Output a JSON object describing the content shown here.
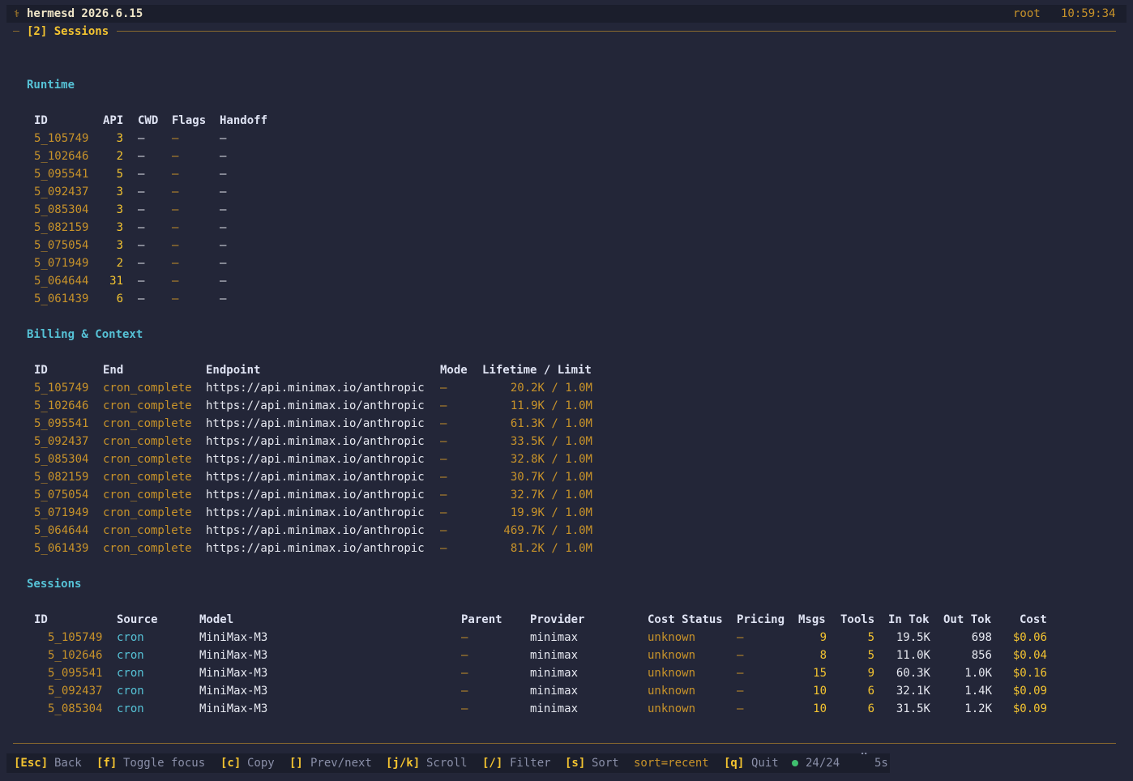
{
  "app": {
    "icon": "caduceus-icon",
    "title": "hermesd 2026.6.15",
    "user": "root",
    "time": "10:59:34",
    "tab": "[2] Sessions"
  },
  "runtime": {
    "heading": "Runtime",
    "columns": [
      "ID",
      "API",
      "CWD",
      "Flags",
      "Handoff"
    ],
    "rows": [
      {
        "id": "5_105749",
        "api": "3",
        "cwd": "—",
        "flags": "—",
        "handoff": "—"
      },
      {
        "id": "5_102646",
        "api": "2",
        "cwd": "—",
        "flags": "—",
        "handoff": "—"
      },
      {
        "id": "5_095541",
        "api": "5",
        "cwd": "—",
        "flags": "—",
        "handoff": "—"
      },
      {
        "id": "5_092437",
        "api": "3",
        "cwd": "—",
        "flags": "—",
        "handoff": "—"
      },
      {
        "id": "5_085304",
        "api": "3",
        "cwd": "—",
        "flags": "—",
        "handoff": "—"
      },
      {
        "id": "5_082159",
        "api": "3",
        "cwd": "—",
        "flags": "—",
        "handoff": "—"
      },
      {
        "id": "5_075054",
        "api": "3",
        "cwd": "—",
        "flags": "—",
        "handoff": "—"
      },
      {
        "id": "5_071949",
        "api": "2",
        "cwd": "—",
        "flags": "—",
        "handoff": "—"
      },
      {
        "id": "5_064644",
        "api": "31",
        "cwd": "—",
        "flags": "—",
        "handoff": "—"
      },
      {
        "id": "5_061439",
        "api": "6",
        "cwd": "—",
        "flags": "—",
        "handoff": "—"
      }
    ]
  },
  "billing": {
    "heading": "Billing & Context",
    "columns": [
      "ID",
      "End",
      "Endpoint",
      "Mode",
      "Lifetime / Limit"
    ],
    "rows": [
      {
        "id": "5_105749",
        "end": "cron_complete",
        "endpoint": "https://api.minimax.io/anthropic",
        "mode": "—",
        "lifetime": "20.2K / 1.0M"
      },
      {
        "id": "5_102646",
        "end": "cron_complete",
        "endpoint": "https://api.minimax.io/anthropic",
        "mode": "—",
        "lifetime": "11.9K / 1.0M"
      },
      {
        "id": "5_095541",
        "end": "cron_complete",
        "endpoint": "https://api.minimax.io/anthropic",
        "mode": "—",
        "lifetime": "61.3K / 1.0M"
      },
      {
        "id": "5_092437",
        "end": "cron_complete",
        "endpoint": "https://api.minimax.io/anthropic",
        "mode": "—",
        "lifetime": "33.5K / 1.0M"
      },
      {
        "id": "5_085304",
        "end": "cron_complete",
        "endpoint": "https://api.minimax.io/anthropic",
        "mode": "—",
        "lifetime": "32.8K / 1.0M"
      },
      {
        "id": "5_082159",
        "end": "cron_complete",
        "endpoint": "https://api.minimax.io/anthropic",
        "mode": "—",
        "lifetime": "30.7K / 1.0M"
      },
      {
        "id": "5_075054",
        "end": "cron_complete",
        "endpoint": "https://api.minimax.io/anthropic",
        "mode": "—",
        "lifetime": "32.7K / 1.0M"
      },
      {
        "id": "5_071949",
        "end": "cron_complete",
        "endpoint": "https://api.minimax.io/anthropic",
        "mode": "—",
        "lifetime": "19.9K / 1.0M"
      },
      {
        "id": "5_064644",
        "end": "cron_complete",
        "endpoint": "https://api.minimax.io/anthropic",
        "mode": "—",
        "lifetime": "469.7K / 1.0M"
      },
      {
        "id": "5_061439",
        "end": "cron_complete",
        "endpoint": "https://api.minimax.io/anthropic",
        "mode": "—",
        "lifetime": "81.2K / 1.0M"
      }
    ]
  },
  "sessions": {
    "heading": "Sessions",
    "columns": [
      "ID",
      "Source",
      "Model",
      "Parent",
      "Provider",
      "Cost Status",
      "Pricing",
      "Msgs",
      "Tools",
      "In Tok",
      "Out Tok",
      "Cost"
    ],
    "rows": [
      {
        "id": "5_105749",
        "source": "cron",
        "model": "MiniMax-M3",
        "parent": "—",
        "provider": "minimax",
        "cost_status": "unknown",
        "pricing": "—",
        "msgs": "9",
        "tools": "5",
        "in_tok": "19.5K",
        "out_tok": "698",
        "cost": "$0.06"
      },
      {
        "id": "5_102646",
        "source": "cron",
        "model": "MiniMax-M3",
        "parent": "—",
        "provider": "minimax",
        "cost_status": "unknown",
        "pricing": "—",
        "msgs": "8",
        "tools": "5",
        "in_tok": "11.0K",
        "out_tok": "856",
        "cost": "$0.04"
      },
      {
        "id": "5_095541",
        "source": "cron",
        "model": "MiniMax-M3",
        "parent": "—",
        "provider": "minimax",
        "cost_status": "unknown",
        "pricing": "—",
        "msgs": "15",
        "tools": "9",
        "in_tok": "60.3K",
        "out_tok": "1.0K",
        "cost": "$0.16"
      },
      {
        "id": "5_092437",
        "source": "cron",
        "model": "MiniMax-M3",
        "parent": "—",
        "provider": "minimax",
        "cost_status": "unknown",
        "pricing": "—",
        "msgs": "10",
        "tools": "6",
        "in_tok": "32.1K",
        "out_tok": "1.4K",
        "cost": "$0.09"
      },
      {
        "id": "5_085304",
        "source": "cron",
        "model": "MiniMax-M3",
        "parent": "—",
        "provider": "minimax",
        "cost_status": "unknown",
        "pricing": "—",
        "msgs": "10",
        "tools": "6",
        "in_tok": "31.5K",
        "out_tok": "1.2K",
        "cost": "$0.09"
      }
    ]
  },
  "footer": {
    "keys": [
      {
        "key": "[Esc]",
        "label": "Back"
      },
      {
        "key": "[f]",
        "label": "Toggle focus"
      },
      {
        "key": "[c]",
        "label": "Copy"
      },
      {
        "key": "[]",
        "label": "Prev/next"
      },
      {
        "key": "[j/k]",
        "label": "Scroll"
      },
      {
        "key": "[/]",
        "label": "Filter"
      },
      {
        "key": "[s]",
        "label": "Sort"
      }
    ],
    "sort": "sort=recent",
    "quit_key": "[q]",
    "quit_label": "Quit",
    "count": "24/24",
    "spinner": "⠉",
    "refresh": "5s"
  },
  "colors": {
    "background": "#232638",
    "accent_yellow": "#f4c430",
    "accent_orange": "#c8932a",
    "accent_cyan": "#56c2d6",
    "status_green": "#3fbf6f"
  }
}
